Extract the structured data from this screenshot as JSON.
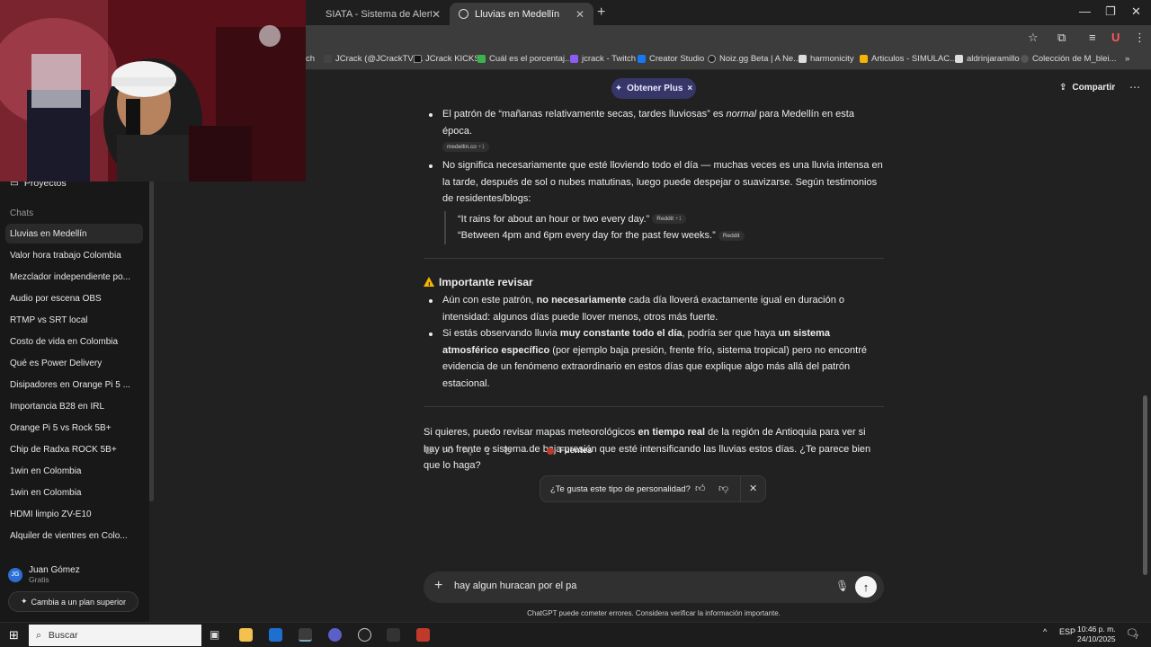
{
  "browser": {
    "tabs": [
      {
        "title": "SIATA - Sistema de Alerta Temp",
        "active": false
      },
      {
        "title": "Lluvias en Medellín",
        "active": true
      }
    ],
    "bookmarks": [
      "ch",
      "JCrack (@JCrackTV)...",
      "JCrack KICKS",
      "Cuál es el porcentaj...",
      "jcrack - Twitch",
      "Creator Studio",
      "Noiz.gg Beta | A Ne...",
      "harmonicity",
      "Articulos - SIMULAC...",
      "aldrinjaramillo",
      "Colección de M_blei..."
    ]
  },
  "header": {
    "plus_label": "Obtener Plus",
    "share_label": "Compartir"
  },
  "sidebar": {
    "projects_label": "Proyectos",
    "chats_heading": "Chats",
    "items": [
      "Lluvias en Medellín",
      "Valor hora trabajo Colombia",
      "Mezclador independiente po...",
      "Audio por escena OBS",
      "RTMP vs SRT local",
      "Costo de vida en Colombia",
      "Qué es Power Delivery",
      "Disipadores en Orange Pi 5 ...",
      "Importancia B28 en IRL",
      "Orange Pi 5 vs Rock 5B+",
      "Chip de Radxa ROCK 5B+",
      "1win en Colombia",
      "1win en Colombia",
      "HDMI limpio ZV-E10",
      "Alquiler de vientres en Colo..."
    ],
    "user_name": "Juan Gómez",
    "user_initials": "JG",
    "user_plan": "Gratis",
    "upgrade_label": "Cambia a un plan superior"
  },
  "message": {
    "b1_pre": "El patrón de “mañanas relativamente secas, tardes lluviosas” es ",
    "b1_em": "normal",
    "b1_post": " para Medellín en esta época.",
    "cite1": "medellin.co",
    "cite1_n": "+1",
    "b2": "No significa necesariamente que esté lloviendo todo el día — muchas veces es una lluvia intensa en la tarde, después de sol o nubes matutinas, luego puede despejar o suavizarse. Según testimonios de residentes/blogs:",
    "q1": "“It rains for about an hour or two every day.”",
    "q1_cite": "Reddit",
    "q1_cite_n": "+1",
    "q2": "“Between 4pm and 6pm every day for the past few weeks.”",
    "q2_cite": "Reddit",
    "h_review": "Importante revisar",
    "r1_pre": "Aún con este patrón, ",
    "r1_b": "no necesariamente",
    "r1_post": " cada día lloverá exactamente igual en duración o intensidad: algunos días puede llover menos, otros más fuerte.",
    "r2_pre": "Si estás observando lluvia ",
    "r2_b1": "muy constante todo el día",
    "r2_mid": ", podría ser que haya ",
    "r2_b2": "un sistema atmosférico específico",
    "r2_post": " (por ejemplo baja presión, frente frío, sistema tropical) pero no encontré evidencia de un fenómeno extraordinario en estos días que explique algo más allá del patrón estacional.",
    "p_pre": "Si quieres, puedo revisar mapas meteorológicos ",
    "p_b": "en tiempo real",
    "p_post": " de la región de Antioquia para ver si hay un frente o sistema de baja presión que esté intensificando las lluvias estos días. ¿Te parece bien que lo haga?",
    "sources_label": "Fuentes"
  },
  "feedback": {
    "question": "¿Te gusta este tipo de personalidad?"
  },
  "composer": {
    "value": "hay algun huracan por el pa",
    "disclaimer": "ChatGPT puede cometer errores. Considera verificar la información importante."
  },
  "taskbar": {
    "search": "Buscar",
    "lang": "ESP",
    "time": "10:46 p. m.",
    "date": "24/10/2025",
    "notif": "7"
  }
}
